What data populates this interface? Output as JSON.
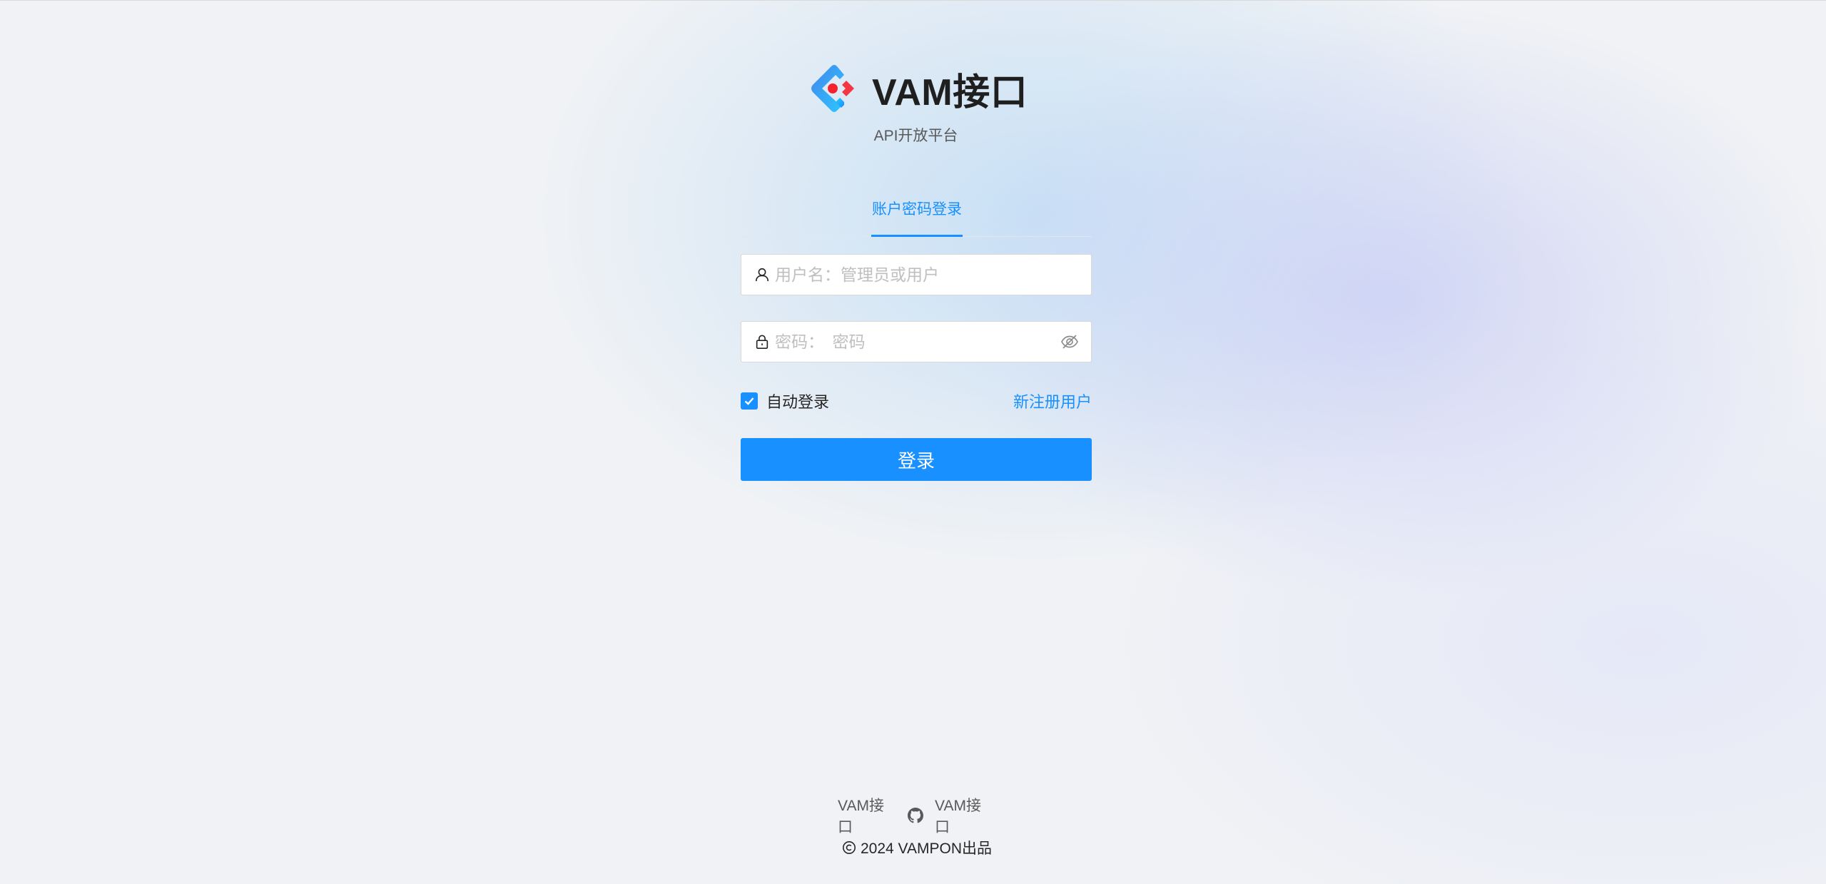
{
  "brand": {
    "title": "VAM接口",
    "subtitle": "API开放平台",
    "logo_icon": "ant-design-logo-icon"
  },
  "login": {
    "tab_label": "账户密码登录",
    "username": {
      "placeholder": "用户名：管理员或用户",
      "value": "",
      "icon": "user-icon"
    },
    "password": {
      "placeholder": "密码：　密码",
      "value": "",
      "icon": "lock-icon",
      "toggle_icon": "eye-invisible-icon"
    },
    "remember": {
      "label": "自动登录",
      "checked": true
    },
    "register_label": "新注册用户",
    "submit_label": "登录"
  },
  "footer": {
    "link_left": "VAM接口",
    "link_right": "VAM接口",
    "github_icon": "github-icon",
    "copyright": "2024 VAMPON出品",
    "copyright_icon": "copyright-icon"
  },
  "colors": {
    "primary": "#1890ff",
    "background": "#f0f2f5",
    "logo_blue": "#1677ff",
    "logo_red": "#f5222d"
  }
}
